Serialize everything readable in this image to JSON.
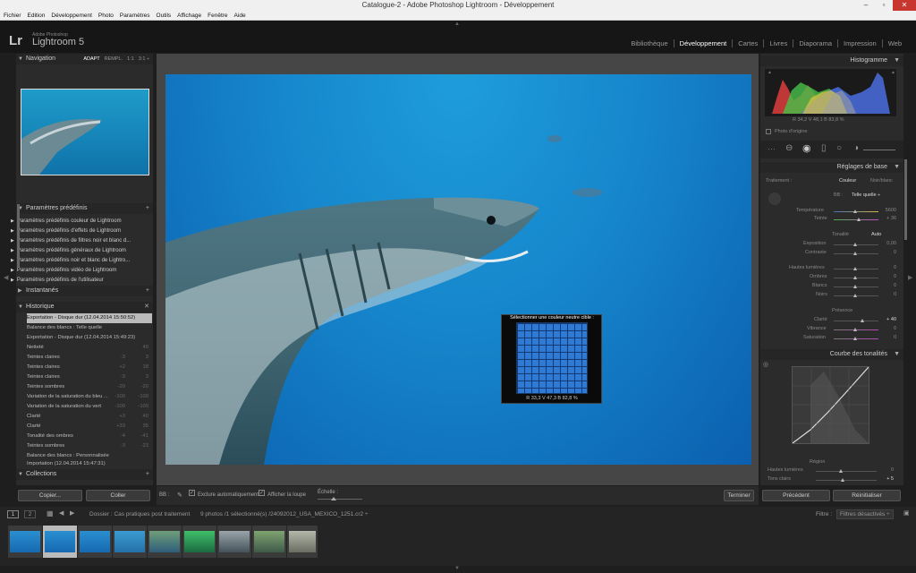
{
  "window": {
    "title": "Catalogue-2 - Adobe Photoshop Lightroom - Développement",
    "controls": [
      "–",
      "▫",
      "✕"
    ]
  },
  "menu": [
    "Fichier",
    "Edition",
    "Développement",
    "Photo",
    "Paramètres",
    "Outils",
    "Affichage",
    "Fenêtre",
    "Aide"
  ],
  "identity": {
    "badge": "Lr",
    "line1": "Adobe Photoshop",
    "line2": "Lightroom 5"
  },
  "modules": [
    "Bibliothèque",
    "Développement",
    "Cartes",
    "Livres",
    "Diaporama",
    "Impression",
    "Web"
  ],
  "active_module": "Développement",
  "navigator": {
    "title": "Navigation",
    "zoom": [
      "ADAPT",
      "REMPL.",
      "1:1",
      "3:1 ÷"
    ]
  },
  "presets": {
    "title": "Paramètres prédéfinis",
    "items": [
      "Paramètres prédéfinis couleur de Lightroom",
      "Paramètres prédéfinis d'effets de Lightroom",
      "Paramètres prédéfinis de filtres noir et blanc d...",
      "Paramètres prédéfinis généraux de Lightroom",
      "Paramètres prédéfinis noir et blanc de Lightro...",
      "Paramètres prédéfinis vidéo de Lightroom",
      "Paramètres prédéfinis de l'utilisateur"
    ]
  },
  "snapshots": {
    "title": "Instantanés"
  },
  "history": {
    "title": "Historique",
    "items": [
      {
        "label": "Exportation - Disque dur (12.04.2014 15:50:52)",
        "a": "",
        "b": ""
      },
      {
        "label": "Balance des blancs : Telle quelle",
        "a": "",
        "b": ""
      },
      {
        "label": "Exportation - Disque dur (12.04.2014 15:49:23)",
        "a": "",
        "b": ""
      },
      {
        "label": "Netteté",
        "a": "",
        "b": "40"
      },
      {
        "label": "Teintes claires",
        "a": "-3",
        "b": "3"
      },
      {
        "label": "Teintes claires",
        "a": "+2",
        "b": "18"
      },
      {
        "label": "Teintes claires",
        "a": "-3",
        "b": "3"
      },
      {
        "label": "Teintes sombres",
        "a": "-20",
        "b": "-20"
      },
      {
        "label": "Variation de la saturation du bleu ...",
        "a": "-100",
        "b": "-100"
      },
      {
        "label": "Variation de la saturation du vert",
        "a": "-100",
        "b": "-100"
      },
      {
        "label": "Clarté",
        "a": "+3",
        "b": "40"
      },
      {
        "label": "Clarté",
        "a": "+33",
        "b": "35"
      },
      {
        "label": "Tonalité des ombres",
        "a": "-4",
        "b": "-41"
      },
      {
        "label": "Teintes sombres",
        "a": "-3",
        "b": "-23"
      },
      {
        "label": "Balance des blancs : Personnalisée",
        "a": "",
        "b": ""
      },
      {
        "label": "Importation (12.04.2014 15:47:31)",
        "a": "",
        "b": ""
      }
    ]
  },
  "collections": {
    "title": "Collections"
  },
  "left_buttons": {
    "copy": "Copier...",
    "paste": "Coller"
  },
  "loupe": {
    "title": "Sélectionner une couleur neutre cible :",
    "rgb": "R  33,3   V  47,3   B  82,8  %"
  },
  "toolbar": {
    "wb": "BB :",
    "auto_dismiss": "Exclure automatiquement",
    "show_loupe": "Afficher la loupe",
    "scale": "Échelle :",
    "done": "Terminer"
  },
  "histogram": {
    "title": "Histogramme",
    "readout": "R  34,2  V  48,1  B  83,8 %",
    "original": "Photo d'origine"
  },
  "basic": {
    "title": "Réglages de base",
    "treatment": "Traitement :",
    "color": "Couleur",
    "bw": "Noir/blanc",
    "wb_label": "BB :",
    "wb_value": "Telle quelle ÷",
    "temp": {
      "label": "Température",
      "value": "5600",
      "pos": 0.5
    },
    "tint": {
      "label": "Teinte",
      "value": "+ 36",
      "pos": 0.6
    },
    "tone": "Tonalité",
    "auto": "Auto",
    "exposure": {
      "label": "Exposition",
      "value": "0,00",
      "pos": 0.5
    },
    "contrast": {
      "label": "Contraste",
      "value": "0",
      "pos": 0.5
    },
    "highlights": {
      "label": "Hautes lumières",
      "value": "0",
      "pos": 0.5
    },
    "shadows": {
      "label": "Ombres",
      "value": "0",
      "pos": 0.5
    },
    "whites": {
      "label": "Blancs",
      "value": "0",
      "pos": 0.5
    },
    "blacks": {
      "label": "Noirs",
      "value": "0",
      "pos": 0.5
    },
    "presence": "Présence",
    "clarity": {
      "label": "Clarté",
      "value": "+ 40",
      "pos": 0.7
    },
    "vibrance": {
      "label": "Vibrance",
      "value": "0",
      "pos": 0.5
    },
    "saturation": {
      "label": "Saturation",
      "value": "0",
      "pos": 0.5
    }
  },
  "tone_curve": {
    "title": "Courbe des tonalités",
    "region": "Région",
    "highlights": {
      "label": "Hautes lumières",
      "value": "0"
    },
    "lights": {
      "label": "Tons clairs",
      "value": "+ 5"
    }
  },
  "right_buttons": {
    "previous": "Précédent",
    "reset": "Réinitialiser"
  },
  "status": {
    "pages": [
      "1",
      "2"
    ],
    "folder": "Dossier : Cas pratiques post traitement",
    "count": "9 photos /1 sélectionné(s) /24092012_USA_MEXICO_1251.cr2 ÷",
    "filter_label": "Filtre :",
    "filter_value": "Filtres désactivés ÷"
  },
  "colors": {
    "accent": "#ffffff",
    "panel": "#2b2b2b",
    "background": "#464646"
  }
}
